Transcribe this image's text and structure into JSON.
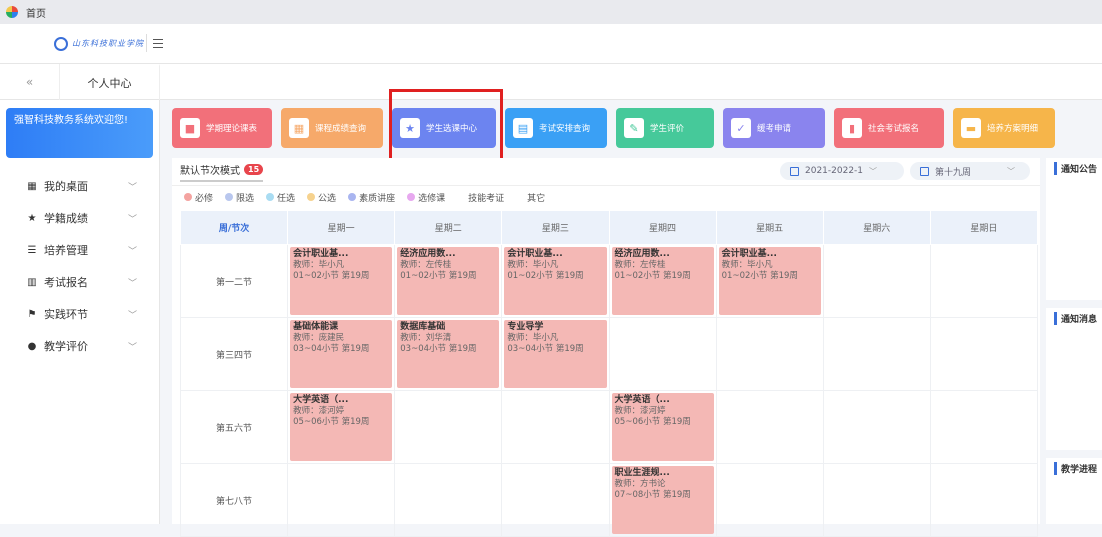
{
  "titlebar": {
    "title": "首页"
  },
  "header": {
    "logo_text": "山东科技职业学院"
  },
  "tabs": {
    "back": "«",
    "active": "个人中心"
  },
  "sidebar": {
    "welcome": "强智科技教务系统欢迎您!",
    "items": [
      {
        "label": "我的桌面",
        "icon": "grid-icon"
      },
      {
        "label": "学籍成绩",
        "icon": "star-icon"
      },
      {
        "label": "培养管理",
        "icon": "stack-icon"
      },
      {
        "label": "考试报名",
        "icon": "books-icon"
      },
      {
        "label": "实践环节",
        "icon": "flag-icon"
      },
      {
        "label": "教学评价",
        "icon": "person-icon"
      }
    ]
  },
  "quick": [
    {
      "label": "学期理论课表",
      "color": "#f2707a",
      "icon": "■"
    },
    {
      "label": "课程成绩查询",
      "color": "#f6a96a",
      "icon": "▦"
    },
    {
      "label": "学生选课中心",
      "color": "#6c84f0",
      "icon": "★"
    },
    {
      "label": "考试安排查询",
      "color": "#3aa0f5",
      "icon": "▤"
    },
    {
      "label": "学生评价",
      "color": "#46c99a",
      "icon": "✎"
    },
    {
      "label": "缓考申请",
      "color": "#8a84ee",
      "icon": "✓"
    },
    {
      "label": "社会考试报名",
      "color": "#f2707a",
      "icon": "▮"
    },
    {
      "label": "培养方案明细",
      "color": "#f6b54a",
      "icon": "▬"
    }
  ],
  "schedule": {
    "mode": "默认节次模式",
    "badge": "15",
    "term": "2021-2022-1",
    "week": "第十九周",
    "legend": [
      {
        "label": "必修",
        "color": "#f4a3a0"
      },
      {
        "label": "限选",
        "color": "#b9c7ee"
      },
      {
        "label": "任选",
        "color": "#a9dcf2"
      },
      {
        "label": "公选",
        "color": "#f6d28e"
      },
      {
        "label": "素质讲座",
        "color": "#a9b5f0"
      },
      {
        "label": "选修课",
        "color": "#e7a8ef"
      },
      {
        "label": "技能考证",
        "color": "#ffffff"
      },
      {
        "label": "其它",
        "color": "#ffffff"
      }
    ],
    "header": [
      "周/节次",
      "星期一",
      "星期二",
      "星期三",
      "星期四",
      "星期五",
      "星期六",
      "星期日"
    ],
    "rows": [
      {
        "period": "第一二节",
        "cells": [
          {
            "name": "会计职业基...",
            "teacher": "教师：毕小凡",
            "time": "01~02小节 第19周"
          },
          {
            "name": "经济应用数...",
            "teacher": "教师：左传桂",
            "time": "01~02小节 第19周"
          },
          {
            "name": "会计职业基...",
            "teacher": "教师：毕小凡",
            "time": "01~02小节 第19周"
          },
          {
            "name": "经济应用数...",
            "teacher": "教师：左传桂",
            "time": "01~02小节 第19周"
          },
          {
            "name": "会计职业基...",
            "teacher": "教师：毕小凡",
            "time": "01~02小节 第19周"
          },
          null,
          null
        ]
      },
      {
        "period": "第三四节",
        "cells": [
          {
            "name": "基础体能课",
            "teacher": "教师：庞建民",
            "time": "03~04小节 第19周"
          },
          {
            "name": "数据库基础",
            "teacher": "教师：刘华清",
            "time": "03~04小节 第19周"
          },
          {
            "name": "专业导学",
            "teacher": "教师：毕小凡",
            "time": "03~04小节 第19周"
          },
          null,
          null,
          null,
          null
        ]
      },
      {
        "period": "第五六节",
        "cells": [
          {
            "name": "大学英语（...",
            "teacher": "教师：漆河婷",
            "time": "05~06小节 第19周"
          },
          null,
          null,
          {
            "name": "大学英语（...",
            "teacher": "教师：漆河婷",
            "time": "05~06小节 第19周"
          },
          null,
          null,
          null
        ]
      },
      {
        "period": "第七八节",
        "cells": [
          null,
          null,
          null,
          {
            "name": "职业生涯规...",
            "teacher": "教师：方书论",
            "time": "07~08小节 第19周"
          },
          null,
          null,
          null
        ]
      }
    ]
  },
  "right": {
    "cards": [
      {
        "title": "通知公告"
      },
      {
        "title": "通知消息"
      },
      {
        "title": "教学进程"
      }
    ]
  }
}
